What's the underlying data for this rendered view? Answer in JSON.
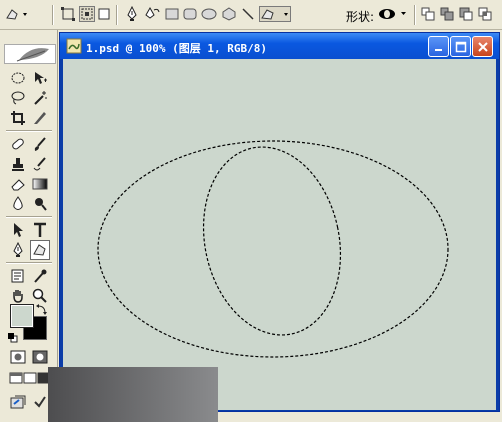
{
  "options_bar": {
    "shape_label": "形状:",
    "tools": [
      "freeform-pen-icon",
      "shape-layers-icon",
      "paths-icon",
      "fill-pixels-icon",
      "pen-icon",
      "freeform-pen-icon",
      "rectangle-icon",
      "rounded-rectangle-icon",
      "ellipse-icon",
      "polygon-icon",
      "line-icon",
      "custom-shape-icon"
    ],
    "ops": [
      "new-area-icon",
      "add-area-icon",
      "subtract-area-icon",
      "intersect-area-icon"
    ]
  },
  "document": {
    "title": "1.psd @ 100% (图层 1, RGB/8)"
  },
  "colors": {
    "canvas": "#ccd7cd",
    "titlebar": "#0a58e0",
    "foreground": "#ccd7cd",
    "background": "#000000"
  }
}
